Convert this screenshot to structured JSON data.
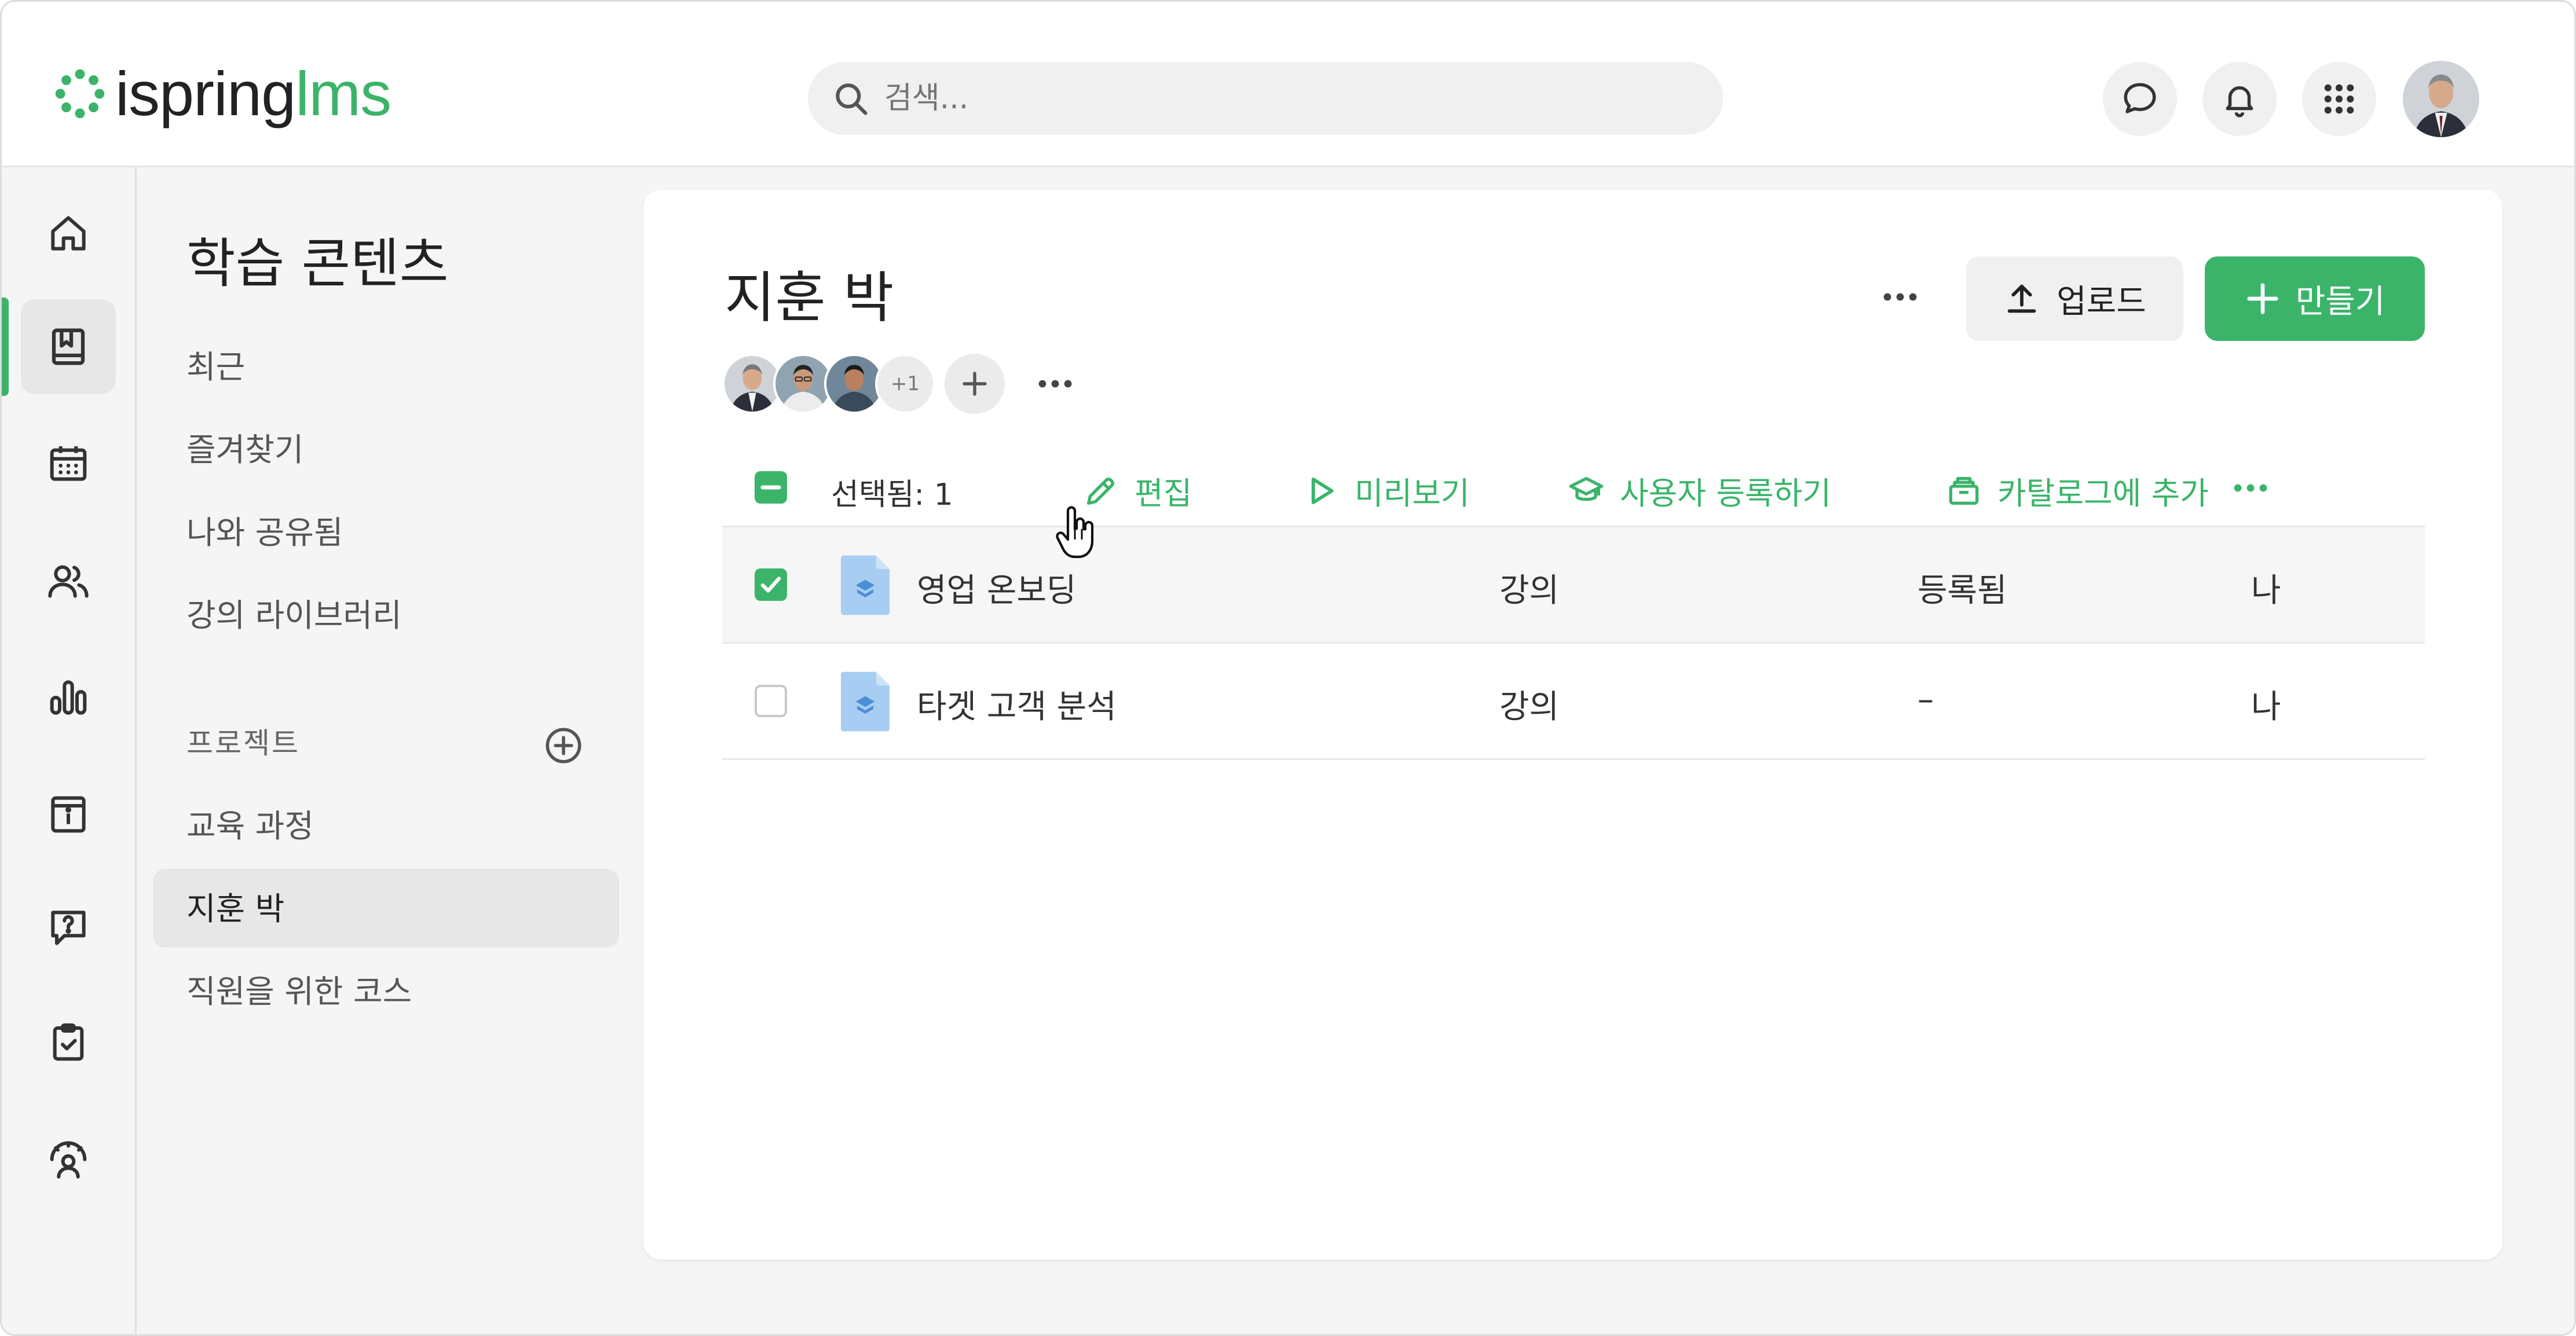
{
  "logo": {
    "text": "ispring",
    "suffix": "lms"
  },
  "search": {
    "placeholder": "검색..."
  },
  "colors": {
    "accent": "#3bb46a",
    "text": "#222222",
    "muted": "#666666"
  },
  "topbar_icons": [
    "chat-icon",
    "bell-icon",
    "apps-grid-icon"
  ],
  "rail_icons": [
    "home-icon",
    "book-icon",
    "calendar-icon",
    "users-icon",
    "chart-icon",
    "info-icon",
    "question-icon",
    "clipboard-icon",
    "gauge-user-icon"
  ],
  "sidebar": {
    "title": "학습 콘텐츠",
    "items": [
      {
        "label": "최근"
      },
      {
        "label": "즐겨찾기"
      },
      {
        "label": "나와 공유됨"
      },
      {
        "label": "강의 라이브러리"
      }
    ],
    "section": "프로젝트",
    "projects": [
      {
        "label": "교육 과정"
      },
      {
        "label": "지훈 박",
        "active": true
      },
      {
        "label": "직원을 위한 코스"
      }
    ]
  },
  "main": {
    "title": "지훈 박",
    "upload_label": "업로드",
    "create_label": "만들기",
    "members_more": "+1",
    "bulk": {
      "selected_label": "선택됨: 1",
      "actions": [
        {
          "label": "편집",
          "icon": "pencil-icon"
        },
        {
          "label": "미리보기",
          "icon": "play-icon"
        },
        {
          "label": "사용자 등록하기",
          "icon": "graduation-cap-icon"
        },
        {
          "label": "카탈로그에 추가",
          "icon": "catalog-icon"
        }
      ]
    },
    "rows": [
      {
        "name": "영업 온보딩",
        "type": "강의",
        "status": "등록됨",
        "owner": "나",
        "checked": true
      },
      {
        "name": "타겟 고객 분석",
        "type": "강의",
        "status": "–",
        "owner": "나",
        "checked": false
      }
    ]
  }
}
